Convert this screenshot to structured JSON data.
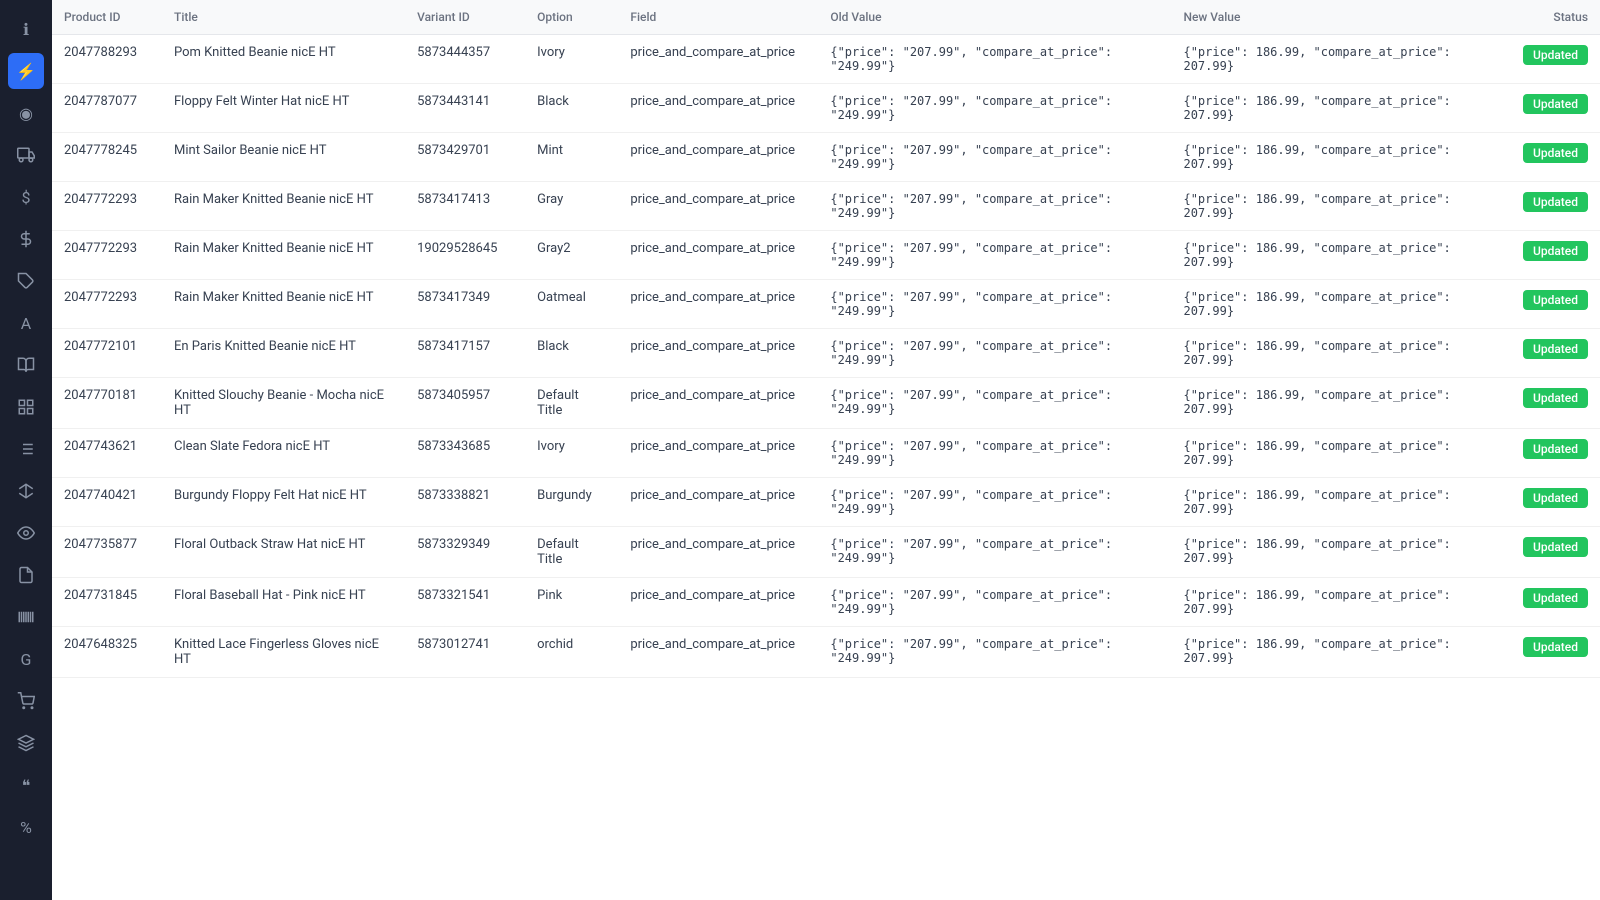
{
  "sidebar": {
    "icons": [
      {
        "name": "info-icon",
        "symbol": "ℹ",
        "active": false
      },
      {
        "name": "bolt-icon",
        "symbol": "⚡",
        "active": true
      },
      {
        "name": "circle-icon",
        "symbol": "◉",
        "active": false
      },
      {
        "name": "truck-icon",
        "symbol": "🚚",
        "active": false
      },
      {
        "name": "dollar-icon",
        "symbol": "$",
        "active": false
      },
      {
        "name": "tag-price-icon",
        "symbol": "＄",
        "active": false
      },
      {
        "name": "tag-icon",
        "symbol": "🏷",
        "active": false
      },
      {
        "name": "text-icon",
        "symbol": "A",
        "active": false
      },
      {
        "name": "book-icon",
        "symbol": "📋",
        "active": false
      },
      {
        "name": "grid-icon",
        "symbol": "⊞",
        "active": false
      },
      {
        "name": "list-icon",
        "symbol": "≡",
        "active": false
      },
      {
        "name": "scale-icon",
        "symbol": "⚖",
        "active": false
      },
      {
        "name": "eye-icon",
        "symbol": "👁",
        "active": false
      },
      {
        "name": "doc-icon",
        "symbol": "📄",
        "active": false
      },
      {
        "name": "barcode-icon",
        "symbol": "▦",
        "active": false
      },
      {
        "name": "g-icon",
        "symbol": "G",
        "active": false
      },
      {
        "name": "cart-icon",
        "symbol": "🛒",
        "active": false
      },
      {
        "name": "layers-icon",
        "symbol": "❋",
        "active": false
      },
      {
        "name": "quote-icon",
        "symbol": "❝",
        "active": false
      },
      {
        "name": "percent-icon",
        "symbol": "%",
        "active": false
      }
    ]
  },
  "table": {
    "columns": [
      "Product ID",
      "Title",
      "Variant ID",
      "Option",
      "Field",
      "Old Value",
      "New Value",
      "Status"
    ],
    "rows": [
      {
        "product_id": "2047788293",
        "title": "Pom Knitted Beanie nicE HT",
        "variant_id": "5873444357",
        "option": "Ivory",
        "field": "price_and_compare_at_price",
        "old_value": "{\"price\": \"207.99\", \"compare_at_price\": \"249.99\"}",
        "new_value": "{\"price\": 186.99, \"compare_at_price\": 207.99}",
        "status": "Updated"
      },
      {
        "product_id": "2047787077",
        "title": "Floppy Felt Winter Hat nicE HT",
        "variant_id": "5873443141",
        "option": "Black",
        "field": "price_and_compare_at_price",
        "old_value": "{\"price\": \"207.99\", \"compare_at_price\": \"249.99\"}",
        "new_value": "{\"price\": 186.99, \"compare_at_price\": 207.99}",
        "status": "Updated"
      },
      {
        "product_id": "2047778245",
        "title": "Mint Sailor Beanie nicE HT",
        "variant_id": "5873429701",
        "option": "Mint",
        "field": "price_and_compare_at_price",
        "old_value": "{\"price\": \"207.99\", \"compare_at_price\": \"249.99\"}",
        "new_value": "{\"price\": 186.99, \"compare_at_price\": 207.99}",
        "status": "Updated"
      },
      {
        "product_id": "2047772293",
        "title": "Rain Maker Knitted Beanie nicE HT",
        "variant_id": "5873417413",
        "option": "Gray",
        "field": "price_and_compare_at_price",
        "old_value": "{\"price\": \"207.99\", \"compare_at_price\": \"249.99\"}",
        "new_value": "{\"price\": 186.99, \"compare_at_price\": 207.99}",
        "status": "Updated"
      },
      {
        "product_id": "2047772293",
        "title": "Rain Maker Knitted Beanie nicE HT",
        "variant_id": "19029528645",
        "option": "Gray2",
        "field": "price_and_compare_at_price",
        "old_value": "{\"price\": \"207.99\", \"compare_at_price\": \"249.99\"}",
        "new_value": "{\"price\": 186.99, \"compare_at_price\": 207.99}",
        "status": "Updated"
      },
      {
        "product_id": "2047772293",
        "title": "Rain Maker Knitted Beanie nicE HT",
        "variant_id": "5873417349",
        "option": "Oatmeal",
        "field": "price_and_compare_at_price",
        "old_value": "{\"price\": \"207.99\", \"compare_at_price\": \"249.99\"}",
        "new_value": "{\"price\": 186.99, \"compare_at_price\": 207.99}",
        "status": "Updated"
      },
      {
        "product_id": "2047772101",
        "title": "En Paris Knitted Beanie nicE HT",
        "variant_id": "5873417157",
        "option": "Black",
        "field": "price_and_compare_at_price",
        "old_value": "{\"price\": \"207.99\", \"compare_at_price\": \"249.99\"}",
        "new_value": "{\"price\": 186.99, \"compare_at_price\": 207.99}",
        "status": "Updated"
      },
      {
        "product_id": "2047770181",
        "title": "Knitted Slouchy Beanie - Mocha nicE HT",
        "variant_id": "5873405957",
        "option": "Default Title",
        "field": "price_and_compare_at_price",
        "old_value": "{\"price\": \"207.99\", \"compare_at_price\": \"249.99\"}",
        "new_value": "{\"price\": 186.99, \"compare_at_price\": 207.99}",
        "status": "Updated"
      },
      {
        "product_id": "2047743621",
        "title": "Clean Slate Fedora nicE HT",
        "variant_id": "5873343685",
        "option": "Ivory",
        "field": "price_and_compare_at_price",
        "old_value": "{\"price\": \"207.99\", \"compare_at_price\": \"249.99\"}",
        "new_value": "{\"price\": 186.99, \"compare_at_price\": 207.99}",
        "status": "Updated"
      },
      {
        "product_id": "2047740421",
        "title": "Burgundy Floppy Felt Hat nicE HT",
        "variant_id": "5873338821",
        "option": "Burgundy",
        "field": "price_and_compare_at_price",
        "old_value": "{\"price\": \"207.99\", \"compare_at_price\": \"249.99\"}",
        "new_value": "{\"price\": 186.99, \"compare_at_price\": 207.99}",
        "status": "Updated"
      },
      {
        "product_id": "2047735877",
        "title": "Floral Outback Straw Hat nicE HT",
        "variant_id": "5873329349",
        "option": "Default Title",
        "field": "price_and_compare_at_price",
        "old_value": "{\"price\": \"207.99\", \"compare_at_price\": \"249.99\"}",
        "new_value": "{\"price\": 186.99, \"compare_at_price\": 207.99}",
        "status": "Updated"
      },
      {
        "product_id": "2047731845",
        "title": "Floral Baseball Hat - Pink nicE HT",
        "variant_id": "5873321541",
        "option": "Pink",
        "field": "price_and_compare_at_price",
        "old_value": "{\"price\": \"207.99\", \"compare_at_price\": \"249.99\"}",
        "new_value": "{\"price\": 186.99, \"compare_at_price\": 207.99}",
        "status": "Updated"
      },
      {
        "product_id": "2047648325",
        "title": "Knitted Lace Fingerless Gloves nicE HT",
        "variant_id": "5873012741",
        "option": "orchid",
        "field": "price_and_compare_at_price",
        "old_value": "{\"price\": \"207.99\", \"compare_at_price\": \"249.99\"}",
        "new_value": "{\"price\": 186.99, \"compare_at_price\": 207.99}",
        "status": "Updated"
      }
    ]
  }
}
